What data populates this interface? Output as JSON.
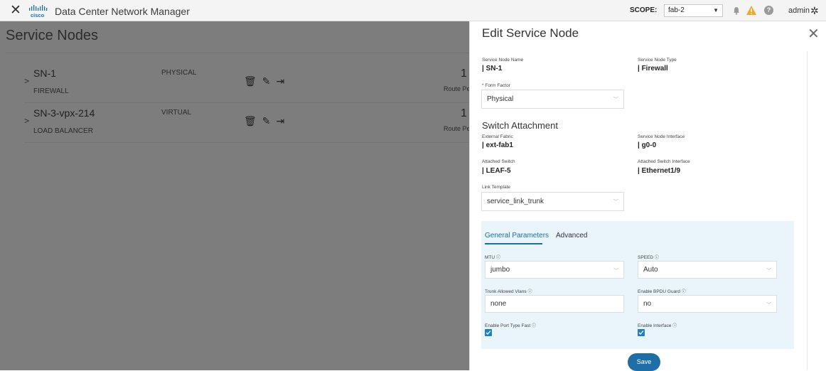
{
  "topbar": {
    "close_icon": "close-icon",
    "logo_text": "cisco",
    "app_title": "Data Center Network Manager",
    "scope_label": "SCOPE:",
    "scope_value": "fab-2",
    "user": "admin",
    "icons": [
      "bell-icon",
      "warning-icon",
      "help-icon",
      "gear-icon"
    ],
    "warning_color": "#f5a623"
  },
  "page": {
    "title": "Service Nodes",
    "nodes": [
      {
        "name": "SN-1",
        "form": "PHYSICAL",
        "type": "FIREWALL",
        "count": "1",
        "count_label": "Route Peering"
      },
      {
        "name": "SN-3-vpx-214",
        "form": "VIRTUAL",
        "type": "LOAD BALANCER",
        "count": "1",
        "count_label": "Route Peering"
      }
    ]
  },
  "panel": {
    "title": "Edit Service Node",
    "service_node_name_label": "Service Node Name",
    "service_node_name": "| SN-1",
    "service_node_type_label": "Service Node Type",
    "service_node_type": "| Firewall",
    "form_factor_required": "*",
    "form_factor_label": "Form Factor",
    "form_factor_value": "Physical",
    "switch_attachment_title": "Switch Attachment",
    "external_fabric_label": "External Fabric",
    "external_fabric": "| ext-fab1",
    "service_node_interface_label": "Service Node Interface",
    "service_node_interface": "| g0-0",
    "attached_switch_label": "Attached Switch",
    "attached_switch": "| LEAF-5",
    "attached_switch_interface_label": "Attached Switch Interface",
    "attached_switch_interface": "| Ethernet1/9",
    "link_template_label": "Link Template",
    "link_template_value": "service_link_trunk",
    "tabs": {
      "general": "General Parameters",
      "advanced": "Advanced"
    },
    "mtu_label": "MTU",
    "mtu_value": "jumbo",
    "speed_label": "SPEED",
    "speed_value": "Auto",
    "trunk_label": "Trunk Allowed Vlans",
    "trunk_value": "none",
    "bpdu_label": "Enable BPDU Guard",
    "bpdu_value": "no",
    "port_fast_label": "Enable Port Type Fast",
    "port_fast_checked": true,
    "enable_interface_label": "Enable Interface",
    "enable_interface_checked": true,
    "save_label": "Save"
  },
  "colors": {
    "accent": "#1e6fa8",
    "overlay": "#7d7d7d",
    "params_bg": "#eaf5fb"
  }
}
